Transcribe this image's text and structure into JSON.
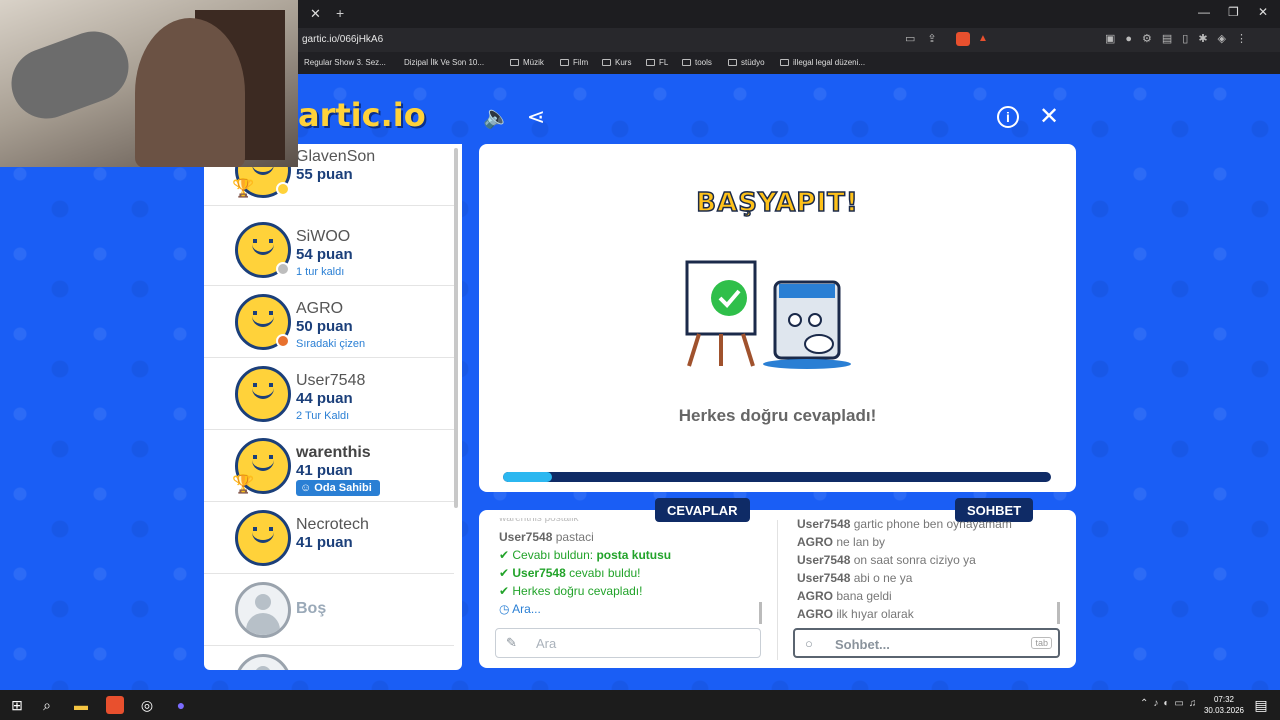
{
  "browser": {
    "url": "gartic.io/066jHkA6",
    "bookmarks": [
      "Regular Show 3. Sez...",
      "Dizipal İlk Ve Son 10...",
      "Müzik",
      "Film",
      "Kurs",
      "FL",
      "tools",
      "stüdyo",
      "illegal legal düzeni..."
    ]
  },
  "game": {
    "logo": "artic.io",
    "players": [
      {
        "name": "GlavenSon",
        "score": "55 puan",
        "sub": ""
      },
      {
        "name": "SiWOO",
        "score": "54 puan",
        "sub": "1 tur kaldı"
      },
      {
        "name": "AGRO",
        "score": "50 puan",
        "sub": "Sıradaki çizen"
      },
      {
        "name": "User7548",
        "score": "44 puan",
        "sub": "2 Tur Kaldı"
      },
      {
        "name": "warenthis",
        "score": "41 puan",
        "badge": "Oda Sahibi"
      },
      {
        "name": "Necrotech",
        "score": "41 puan",
        "sub": ""
      },
      {
        "name": "Boş"
      }
    ],
    "board": {
      "banner": "BAŞYAPIT!",
      "message": "Herkes doğru cevapladı!",
      "progress": 0.09
    },
    "answers": {
      "tab": "CEVAPLAR",
      "top_partial": "warenthis postalik",
      "messages": [
        {
          "user": "User7548",
          "text": "pastaci"
        },
        {
          "label": "Cevabı buldun:",
          "answer": "posta kutusu"
        },
        {
          "user": "User7548",
          "text": "cevabı buldu!"
        },
        {
          "text": "Herkes doğru cevapladı!"
        },
        {
          "text": "Ara..."
        }
      ],
      "placeholder": "Ara"
    },
    "chat": {
      "tab": "SOHBET",
      "messages": [
        {
          "user": "User7548",
          "text": "gartic phone ben oynayamam"
        },
        {
          "user": "AGRO",
          "text": "ne lan by"
        },
        {
          "user": "User7548",
          "text": "on saat sonra ciziyo ya"
        },
        {
          "user": "User7548",
          "text": "abi o ne ya"
        },
        {
          "user": "AGRO",
          "text": "bana geldi"
        },
        {
          "user": "AGRO",
          "text": "ilk hıyar olarak"
        }
      ],
      "placeholder": "Sohbet...",
      "tab_key": "tab"
    }
  },
  "taskbar": {
    "time": "07:32",
    "date": "30.03.2026"
  }
}
